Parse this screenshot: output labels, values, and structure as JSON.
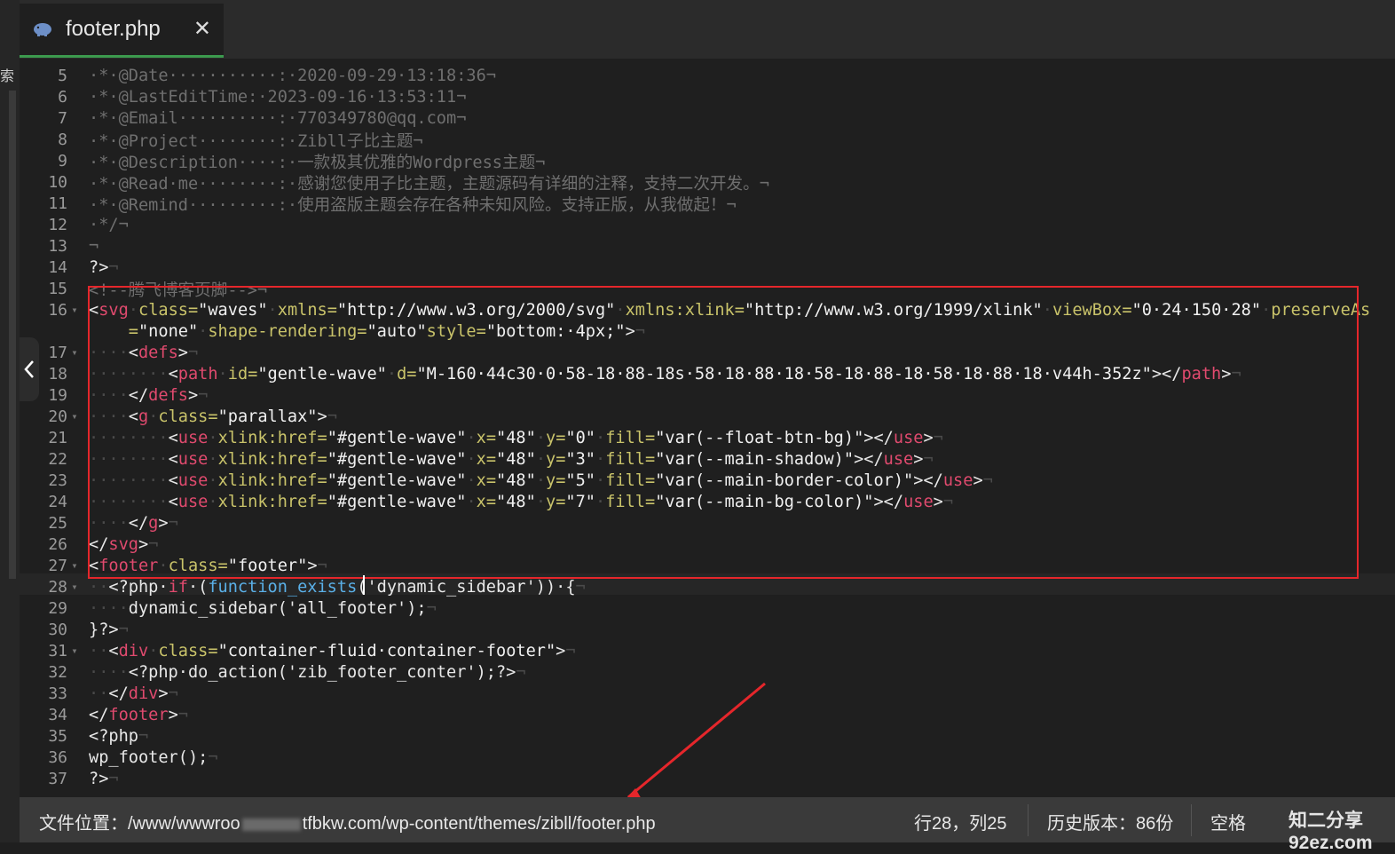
{
  "tab": {
    "title": "footer.php",
    "icon": "php-elephant-icon",
    "close_glyph": "✕"
  },
  "sidebar": {
    "search_label": "索"
  },
  "editor": {
    "lines": [
      {
        "num": "5",
        "fold": "",
        "segments": [
          {
            "t": "·*·@Date···········:·2020-09-29·13:18:36¬",
            "c": "c-com"
          }
        ]
      },
      {
        "num": "6",
        "fold": "",
        "segments": [
          {
            "t": "·*·@LastEditTime:·2023-09-16·13:53:11¬",
            "c": "c-com"
          }
        ]
      },
      {
        "num": "7",
        "fold": "",
        "segments": [
          {
            "t": "·*·@Email··········:·770349780@qq.com¬",
            "c": "c-com"
          }
        ]
      },
      {
        "num": "8",
        "fold": "",
        "segments": [
          {
            "t": "·*·@Project········:·Zibll子比主题¬",
            "c": "c-com"
          }
        ]
      },
      {
        "num": "9",
        "fold": "",
        "segments": [
          {
            "t": "·*·@Description····:·一款极其优雅的Wordpress主题¬",
            "c": "c-com"
          }
        ]
      },
      {
        "num": "10",
        "fold": "",
        "segments": [
          {
            "t": "·*·@Read·me········:·感谢您使用子比主题，主题源码有详细的注释，支持二次开发。¬",
            "c": "c-com"
          }
        ]
      },
      {
        "num": "11",
        "fold": "",
        "segments": [
          {
            "t": "·*·@Remind·········:·使用盗版主题会存在各种未知风险。支持正版，从我做起！¬",
            "c": "c-com"
          }
        ]
      },
      {
        "num": "12",
        "fold": "",
        "segments": [
          {
            "t": "·*/¬",
            "c": "c-com"
          }
        ]
      },
      {
        "num": "13",
        "fold": "",
        "segments": [
          {
            "t": "¬",
            "c": "c-com"
          }
        ]
      },
      {
        "num": "14",
        "fold": "",
        "segments": [
          {
            "t": "?>",
            "c": ""
          },
          {
            "t": "¬",
            "c": "c-ws"
          }
        ]
      },
      {
        "num": "15",
        "fold": "",
        "segments": [
          {
            "t": "<!--腾飞博客页脚-->¬",
            "c": "c-com"
          }
        ]
      },
      {
        "num": "16",
        "fold": "▾",
        "segments": [
          {
            "t": "<",
            "c": ""
          },
          {
            "t": "svg",
            "c": "c-tag"
          },
          {
            "t": "·",
            "c": "c-ws"
          },
          {
            "t": "class=",
            "c": "c-attr"
          },
          {
            "t": "\"waves\"",
            "c": "c-str"
          },
          {
            "t": "·",
            "c": "c-ws"
          },
          {
            "t": "xmlns=",
            "c": "c-attr"
          },
          {
            "t": "\"http://www.w3.org/2000/svg\"",
            "c": "c-str"
          },
          {
            "t": "·",
            "c": "c-ws"
          },
          {
            "t": "xmlns:xlink=",
            "c": "c-attr"
          },
          {
            "t": "\"http://www.w3.org/1999/xlink\"",
            "c": "c-str"
          },
          {
            "t": "·",
            "c": "c-ws"
          },
          {
            "t": "viewBox=",
            "c": "c-attr"
          },
          {
            "t": "\"0·24·150·28\"",
            "c": "c-str"
          },
          {
            "t": "·",
            "c": "c-ws"
          },
          {
            "t": "preserveAs",
            "c": "c-attr"
          }
        ]
      },
      {
        "num": "",
        "fold": "",
        "segments": [
          {
            "t": "    =",
            "c": "c-attr"
          },
          {
            "t": "\"none\"",
            "c": "c-str"
          },
          {
            "t": "·",
            "c": "c-ws"
          },
          {
            "t": "shape-rendering=",
            "c": "c-attr"
          },
          {
            "t": "\"auto\"",
            "c": "c-str"
          },
          {
            "t": "style=",
            "c": "c-attr"
          },
          {
            "t": "\"bottom:·4px;\"",
            "c": "c-str"
          },
          {
            "t": ">",
            "c": ""
          },
          {
            "t": "¬",
            "c": "c-ws"
          }
        ]
      },
      {
        "num": "17",
        "fold": "▾",
        "segments": [
          {
            "t": "····",
            "c": "c-ws"
          },
          {
            "t": "<",
            "c": ""
          },
          {
            "t": "defs",
            "c": "c-tag"
          },
          {
            "t": ">",
            "c": ""
          },
          {
            "t": "¬",
            "c": "c-ws"
          }
        ]
      },
      {
        "num": "18",
        "fold": "",
        "segments": [
          {
            "t": "········",
            "c": "c-ws"
          },
          {
            "t": "<",
            "c": ""
          },
          {
            "t": "path",
            "c": "c-tag"
          },
          {
            "t": "·",
            "c": "c-ws"
          },
          {
            "t": "id=",
            "c": "c-attr"
          },
          {
            "t": "\"gentle-wave\"",
            "c": "c-str"
          },
          {
            "t": "·",
            "c": "c-ws"
          },
          {
            "t": "d=",
            "c": "c-attr"
          },
          {
            "t": "\"M-160·44c30·0·58-18·88-18s·58·18·88·18·58-18·88-18·58·18·88·18·v44h-352z\"",
            "c": "c-str"
          },
          {
            "t": "></",
            "c": ""
          },
          {
            "t": "path",
            "c": "c-tag"
          },
          {
            "t": ">",
            "c": ""
          },
          {
            "t": "¬",
            "c": "c-ws"
          }
        ]
      },
      {
        "num": "19",
        "fold": "",
        "segments": [
          {
            "t": "····",
            "c": "c-ws"
          },
          {
            "t": "</",
            "c": ""
          },
          {
            "t": "defs",
            "c": "c-tag"
          },
          {
            "t": ">",
            "c": ""
          },
          {
            "t": "¬",
            "c": "c-ws"
          }
        ]
      },
      {
        "num": "20",
        "fold": "▾",
        "segments": [
          {
            "t": "····",
            "c": "c-ws"
          },
          {
            "t": "<",
            "c": ""
          },
          {
            "t": "g",
            "c": "c-tag"
          },
          {
            "t": "·",
            "c": "c-ws"
          },
          {
            "t": "class=",
            "c": "c-attr"
          },
          {
            "t": "\"parallax\"",
            "c": "c-str"
          },
          {
            "t": ">",
            "c": ""
          },
          {
            "t": "¬",
            "c": "c-ws"
          }
        ]
      },
      {
        "num": "21",
        "fold": "",
        "segments": [
          {
            "t": "········",
            "c": "c-ws"
          },
          {
            "t": "<",
            "c": ""
          },
          {
            "t": "use",
            "c": "c-tag"
          },
          {
            "t": "·",
            "c": "c-ws"
          },
          {
            "t": "xlink:href=",
            "c": "c-attr"
          },
          {
            "t": "\"#gentle-wave\"",
            "c": "c-str"
          },
          {
            "t": "·",
            "c": "c-ws"
          },
          {
            "t": "x=",
            "c": "c-attr"
          },
          {
            "t": "\"48\"",
            "c": "c-str"
          },
          {
            "t": "·",
            "c": "c-ws"
          },
          {
            "t": "y=",
            "c": "c-attr"
          },
          {
            "t": "\"0\"",
            "c": "c-str"
          },
          {
            "t": "·",
            "c": "c-ws"
          },
          {
            "t": "fill=",
            "c": "c-attr"
          },
          {
            "t": "\"var(--float-btn-bg)\"",
            "c": "c-str"
          },
          {
            "t": "></",
            "c": ""
          },
          {
            "t": "use",
            "c": "c-tag"
          },
          {
            "t": ">",
            "c": ""
          },
          {
            "t": "¬",
            "c": "c-ws"
          }
        ]
      },
      {
        "num": "22",
        "fold": "",
        "segments": [
          {
            "t": "········",
            "c": "c-ws"
          },
          {
            "t": "<",
            "c": ""
          },
          {
            "t": "use",
            "c": "c-tag"
          },
          {
            "t": "·",
            "c": "c-ws"
          },
          {
            "t": "xlink:href=",
            "c": "c-attr"
          },
          {
            "t": "\"#gentle-wave\"",
            "c": "c-str"
          },
          {
            "t": "·",
            "c": "c-ws"
          },
          {
            "t": "x=",
            "c": "c-attr"
          },
          {
            "t": "\"48\"",
            "c": "c-str"
          },
          {
            "t": "·",
            "c": "c-ws"
          },
          {
            "t": "y=",
            "c": "c-attr"
          },
          {
            "t": "\"3\"",
            "c": "c-str"
          },
          {
            "t": "·",
            "c": "c-ws"
          },
          {
            "t": "fill=",
            "c": "c-attr"
          },
          {
            "t": "\"var(--main-shadow)\"",
            "c": "c-str"
          },
          {
            "t": "></",
            "c": ""
          },
          {
            "t": "use",
            "c": "c-tag"
          },
          {
            "t": ">",
            "c": ""
          },
          {
            "t": "¬",
            "c": "c-ws"
          }
        ]
      },
      {
        "num": "23",
        "fold": "",
        "segments": [
          {
            "t": "········",
            "c": "c-ws"
          },
          {
            "t": "<",
            "c": ""
          },
          {
            "t": "use",
            "c": "c-tag"
          },
          {
            "t": "·",
            "c": "c-ws"
          },
          {
            "t": "xlink:href=",
            "c": "c-attr"
          },
          {
            "t": "\"#gentle-wave\"",
            "c": "c-str"
          },
          {
            "t": "·",
            "c": "c-ws"
          },
          {
            "t": "x=",
            "c": "c-attr"
          },
          {
            "t": "\"48\"",
            "c": "c-str"
          },
          {
            "t": "·",
            "c": "c-ws"
          },
          {
            "t": "y=",
            "c": "c-attr"
          },
          {
            "t": "\"5\"",
            "c": "c-str"
          },
          {
            "t": "·",
            "c": "c-ws"
          },
          {
            "t": "fill=",
            "c": "c-attr"
          },
          {
            "t": "\"var(--main-border-color)\"",
            "c": "c-str"
          },
          {
            "t": "></",
            "c": ""
          },
          {
            "t": "use",
            "c": "c-tag"
          },
          {
            "t": ">",
            "c": ""
          },
          {
            "t": "¬",
            "c": "c-ws"
          }
        ]
      },
      {
        "num": "24",
        "fold": "",
        "segments": [
          {
            "t": "········",
            "c": "c-ws"
          },
          {
            "t": "<",
            "c": ""
          },
          {
            "t": "use",
            "c": "c-tag"
          },
          {
            "t": "·",
            "c": "c-ws"
          },
          {
            "t": "xlink:href=",
            "c": "c-attr"
          },
          {
            "t": "\"#gentle-wave\"",
            "c": "c-str"
          },
          {
            "t": "·",
            "c": "c-ws"
          },
          {
            "t": "x=",
            "c": "c-attr"
          },
          {
            "t": "\"48\"",
            "c": "c-str"
          },
          {
            "t": "·",
            "c": "c-ws"
          },
          {
            "t": "y=",
            "c": "c-attr"
          },
          {
            "t": "\"7\"",
            "c": "c-str"
          },
          {
            "t": "·",
            "c": "c-ws"
          },
          {
            "t": "fill=",
            "c": "c-attr"
          },
          {
            "t": "\"var(--main-bg-color)\"",
            "c": "c-str"
          },
          {
            "t": "></",
            "c": ""
          },
          {
            "t": "use",
            "c": "c-tag"
          },
          {
            "t": ">",
            "c": ""
          },
          {
            "t": "¬",
            "c": "c-ws"
          }
        ]
      },
      {
        "num": "25",
        "fold": "",
        "segments": [
          {
            "t": "····",
            "c": "c-ws"
          },
          {
            "t": "</",
            "c": ""
          },
          {
            "t": "g",
            "c": "c-tag"
          },
          {
            "t": ">",
            "c": ""
          },
          {
            "t": "¬",
            "c": "c-ws"
          }
        ]
      },
      {
        "num": "26",
        "fold": "",
        "segments": [
          {
            "t": "</",
            "c": ""
          },
          {
            "t": "svg",
            "c": "c-tag"
          },
          {
            "t": ">",
            "c": ""
          },
          {
            "t": "¬",
            "c": "c-ws"
          }
        ]
      },
      {
        "num": "27",
        "fold": "▾",
        "segments": [
          {
            "t": "<",
            "c": ""
          },
          {
            "t": "footer",
            "c": "c-tag"
          },
          {
            "t": "·",
            "c": "c-ws"
          },
          {
            "t": "class=",
            "c": "c-attr"
          },
          {
            "t": "\"footer\"",
            "c": "c-str"
          },
          {
            "t": ">",
            "c": ""
          },
          {
            "t": "¬",
            "c": "c-ws"
          }
        ]
      },
      {
        "num": "28",
        "fold": "▾",
        "segments": [
          {
            "t": "··",
            "c": "c-ws"
          },
          {
            "t": "<?php·",
            "c": ""
          },
          {
            "t": "if",
            "c": "c-kw"
          },
          {
            "t": "·(",
            "c": ""
          },
          {
            "t": "function_exists",
            "c": "c-fn"
          },
          {
            "t": "('dynamic_sidebar'))·{",
            "c": ""
          },
          {
            "t": "¬",
            "c": "c-ws"
          }
        ]
      },
      {
        "num": "29",
        "fold": "",
        "segments": [
          {
            "t": "····",
            "c": "c-ws"
          },
          {
            "t": "dynamic_sidebar('all_footer');",
            "c": ""
          },
          {
            "t": "¬",
            "c": "c-ws"
          }
        ]
      },
      {
        "num": "30",
        "fold": "",
        "segments": [
          {
            "t": "}?>",
            "c": ""
          },
          {
            "t": "¬",
            "c": "c-ws"
          }
        ]
      },
      {
        "num": "31",
        "fold": "▾",
        "segments": [
          {
            "t": "··",
            "c": "c-ws"
          },
          {
            "t": "<",
            "c": ""
          },
          {
            "t": "div",
            "c": "c-tag"
          },
          {
            "t": "·",
            "c": "c-ws"
          },
          {
            "t": "class=",
            "c": "c-attr"
          },
          {
            "t": "\"container-fluid·container-footer\"",
            "c": "c-str"
          },
          {
            "t": ">",
            "c": ""
          },
          {
            "t": "¬",
            "c": "c-ws"
          }
        ]
      },
      {
        "num": "32",
        "fold": "",
        "segments": [
          {
            "t": "····",
            "c": "c-ws"
          },
          {
            "t": "<?php·do_action('zib_footer_conter');?>",
            "c": ""
          },
          {
            "t": "¬",
            "c": "c-ws"
          }
        ]
      },
      {
        "num": "33",
        "fold": "",
        "segments": [
          {
            "t": "··",
            "c": "c-ws"
          },
          {
            "t": "</",
            "c": ""
          },
          {
            "t": "div",
            "c": "c-tag"
          },
          {
            "t": ">",
            "c": ""
          },
          {
            "t": "¬",
            "c": "c-ws"
          }
        ]
      },
      {
        "num": "34",
        "fold": "",
        "segments": [
          {
            "t": "</",
            "c": ""
          },
          {
            "t": "footer",
            "c": "c-tag"
          },
          {
            "t": ">",
            "c": ""
          },
          {
            "t": "¬",
            "c": "c-ws"
          }
        ]
      },
      {
        "num": "35",
        "fold": "",
        "segments": [
          {
            "t": "<?php",
            "c": ""
          },
          {
            "t": "¬",
            "c": "c-ws"
          }
        ]
      },
      {
        "num": "36",
        "fold": "",
        "segments": [
          {
            "t": "wp_footer();",
            "c": ""
          },
          {
            "t": "¬",
            "c": "c-ws"
          }
        ]
      },
      {
        "num": "37",
        "fold": "",
        "segments": [
          {
            "t": "?>",
            "c": ""
          },
          {
            "t": "¬",
            "c": "c-ws"
          }
        ]
      }
    ]
  },
  "status": {
    "path_prefix": "文件位置：/www/wwwroo",
    "path_suffix": "tfbkw.com/wp-content/themes/zibll/footer.php",
    "cursor_pos": "行28，列25",
    "history": "历史版本：86份",
    "indent": "空格",
    "watermark": "知二分享 92ez.com"
  },
  "colors": {
    "tab_active_underline": "#3c9a4e",
    "highlight_box": "#e5262b",
    "arrow": "#e5262b",
    "tag": "#e04a6e",
    "attr": "#c9c36a",
    "function": "#5ab0e8"
  }
}
